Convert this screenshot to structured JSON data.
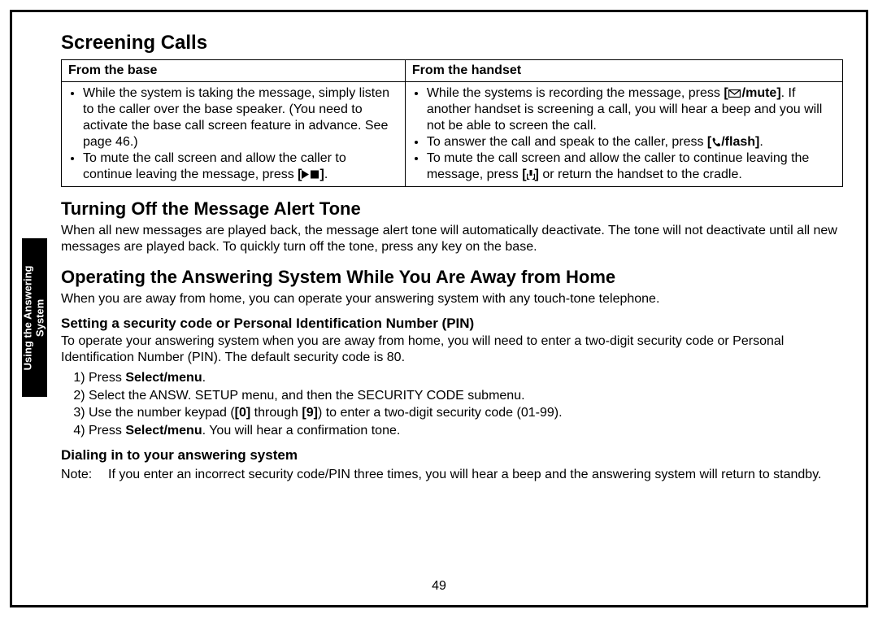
{
  "sideTab": "Using the Answering\nSystem",
  "pageNumber": "49",
  "section1": {
    "title": "Screening Calls",
    "th1": "From the base",
    "th2": "From the handset",
    "base_b1": "While the system is taking the message, simply listen to the caller over the base speaker. (You need to activate the base call screen feature in advance. See page 46.)",
    "base_b2_pre": "To mute the call screen and allow the caller to continue leaving the message, press ",
    "base_b2_post": ".",
    "hs_b1_pre": "While the systems is recording the message, press ",
    "hs_b1_btn": "/mute",
    "hs_b1_post": ". If another handset is screening a call, you will hear a beep and you will not be able to screen the call.",
    "hs_b2_pre": "To answer the call and speak to the caller, press ",
    "hs_b2_btn": "/flash",
    "hs_b2_post": ".",
    "hs_b3_pre": "To mute the call screen and allow the caller to continue leaving the message, press ",
    "hs_b3_post": " or return the handset to the cradle."
  },
  "section2": {
    "title": "Turning Off the Message Alert Tone",
    "body": "When all new messages are played back, the message alert tone will automatically deactivate. The tone will not deactivate until all new messages are played back. To quickly turn off the tone, press any key on the base."
  },
  "section3": {
    "title": "Operating the Answering System While You Are Away from Home",
    "body": "When you are away from home, you can operate your answering system with any touch-tone telephone.",
    "sub1": {
      "title": "Setting a security code or Personal Identification Number (PIN)",
      "body": "To operate your answering system when you are away from home, you will need to enter a two-digit security code or Personal Identification Number (PIN). The default security code is 80.",
      "s1_pre": "Press ",
      "s1_b": "Select/menu",
      "s1_post": ".",
      "s2": "Select the ANSW. SETUP menu, and then the SECURITY CODE submenu.",
      "s3_pre": "Use the number keypad (",
      "s3_b1": "[0]",
      "s3_mid": " through ",
      "s3_b2": "[9]",
      "s3_post": ") to enter a two-digit security code (01-99).",
      "s4_pre": "Press ",
      "s4_b": "Select/menu",
      "s4_post": ". You will hear a confirmation tone."
    },
    "sub2": {
      "title": "Dialing in to your answering system",
      "noteLabel": "Note:",
      "noteBody": "If you enter an incorrect security code/PIN three times, you will hear a beep and the answering system will return to standby."
    }
  }
}
